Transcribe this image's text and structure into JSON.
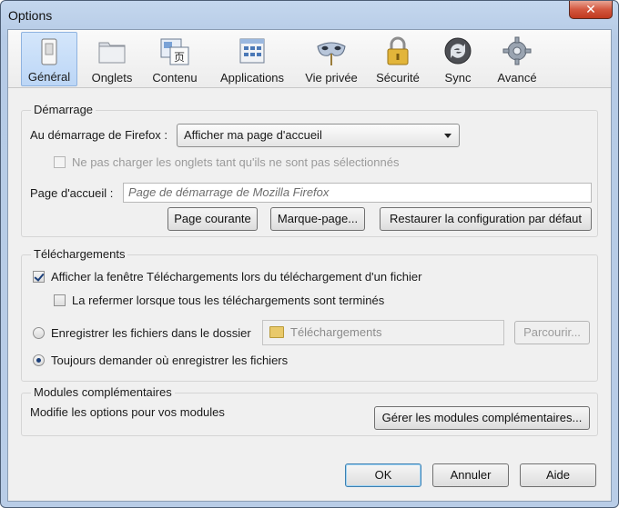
{
  "window": {
    "title": "Options",
    "close_glyph": "✕"
  },
  "toolbar": {
    "panes": [
      {
        "label": "Général",
        "icon": "switch-icon",
        "selected": true
      },
      {
        "label": "Onglets",
        "icon": "tabs-icon",
        "selected": false
      },
      {
        "label": "Contenu",
        "icon": "content-icon",
        "selected": false
      },
      {
        "label": "Applications",
        "icon": "applications-icon",
        "selected": false
      },
      {
        "label": "Vie privée",
        "icon": "mask-icon",
        "selected": false
      },
      {
        "label": "Sécurité",
        "icon": "padlock-icon",
        "selected": false
      },
      {
        "label": "Sync",
        "icon": "sync-icon",
        "selected": false
      },
      {
        "label": "Avancé",
        "icon": "gear-icon",
        "selected": false
      }
    ],
    "content_icon_glyph": "页"
  },
  "startup": {
    "group_title": "Démarrage",
    "when_label": "Au démarrage de Firefox :",
    "when_value": "Afficher ma page d'accueil",
    "dont_load_tabs_label": "Ne pas charger les onglets tant qu'ils ne sont pas sélectionnés",
    "homepage_label": "Page d'accueil :",
    "homepage_placeholder": "Page de démarrage de Mozilla Firefox",
    "use_current_label": "Page courante",
    "use_bookmark_label": "Marque-page...",
    "restore_default_label": "Restaurer la configuration par défaut"
  },
  "downloads": {
    "group_title": "Téléchargements",
    "show_window_label": "Afficher la fenêtre Téléchargements lors du téléchargement d'un fichier",
    "close_when_done_label": "La refermer lorsque tous les téléchargements sont terminés",
    "save_to_label": "Enregistrer les fichiers dans le dossier",
    "folder_value": "Téléchargements",
    "browse_label": "Parcourir...",
    "always_ask_label": "Toujours demander où enregistrer les fichiers"
  },
  "addons": {
    "group_title": "Modules complémentaires",
    "description": "Modifie les options pour vos modules",
    "manage_label": "Gérer les modules complémentaires..."
  },
  "footer": {
    "ok_label": "OK",
    "cancel_label": "Annuler",
    "help_label": "Aide"
  },
  "colors": {
    "selected_pane": "#bcd6f6",
    "dialog_bg": "#f0f0f0",
    "frame": "#b9cde7"
  }
}
